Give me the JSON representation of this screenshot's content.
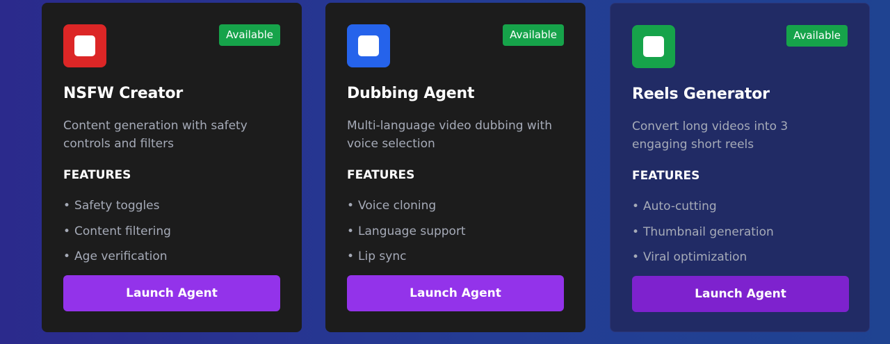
{
  "cards": [
    {
      "badge": "Available",
      "title": "NSFW Creator",
      "description": "Content generation with safety controls and filters",
      "features_heading": "FEATURES",
      "features": [
        "Safety toggles",
        "Content filtering",
        "Age verification"
      ],
      "button_label": "Launch Agent",
      "icon_color": "#dc2626"
    },
    {
      "badge": "Available",
      "title": "Dubbing Agent",
      "description": "Multi-language video dubbing with voice selection",
      "features_heading": "FEATURES",
      "features": [
        "Voice cloning",
        "Language support",
        "Lip sync"
      ],
      "button_label": "Launch Agent",
      "icon_color": "#2563eb"
    },
    {
      "badge": "Available",
      "title": "Reels Generator",
      "description": "Convert long videos into 3 engaging short reels",
      "features_heading": "FEATURES",
      "features": [
        "Auto-cutting",
        "Thumbnail generation",
        "Viral optimization"
      ],
      "button_label": "Launch Agent",
      "icon_color": "#16a34a"
    }
  ],
  "colors": {
    "badge_green": "#16a34a",
    "button_purple": "#9333ea",
    "button_purple_dark": "#7e22ce"
  }
}
